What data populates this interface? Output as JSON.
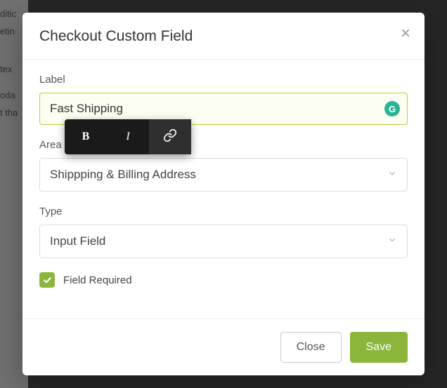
{
  "modal": {
    "title": "Checkout Custom Field",
    "label_field": {
      "label": "Label",
      "value": "Fast Shipping"
    },
    "area_field": {
      "label": "Area",
      "value": "Shippping & Billing Address"
    },
    "type_field": {
      "label": "Type",
      "value": "Input Field"
    },
    "required": {
      "label": "Field Required",
      "checked": true
    },
    "footer": {
      "close": "Close",
      "save": "Save"
    }
  },
  "toolbar": {
    "bold": "B",
    "italic": "I"
  },
  "grammarly": "G",
  "bg_text": [
    "ditic",
    "etin",
    "tex",
    "oda",
    "t tha"
  ],
  "colors": {
    "accent": "#8bb63b",
    "focus_border": "#b8d13c",
    "focus_bg": "#fbfef0",
    "grammarly": "#28b395"
  }
}
